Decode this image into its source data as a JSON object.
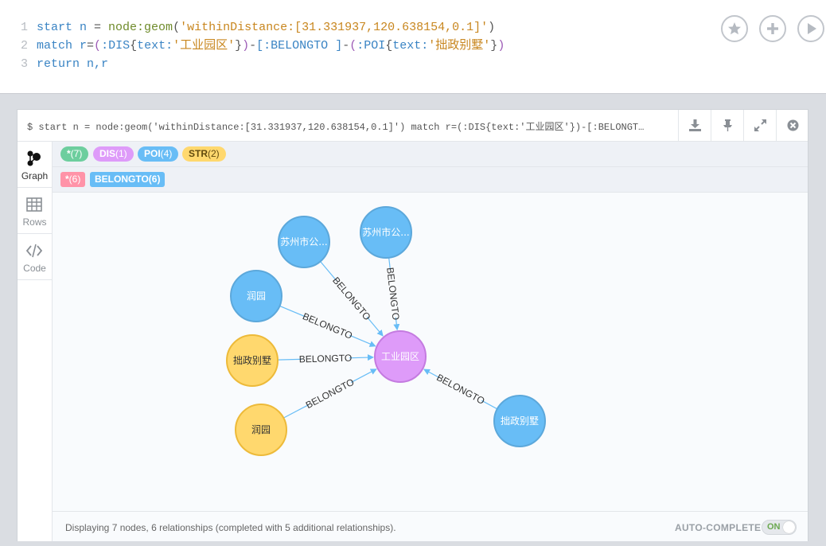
{
  "editor": {
    "line_numbers": [
      "1",
      "2",
      "3"
    ],
    "line1": {
      "kw": "start",
      "var": " n",
      "eq": " = ",
      "fn": "node:geom",
      "open": "(",
      "str": "'withinDistance:[31.331937,120.638154,0.1]'",
      "close": ")"
    },
    "line2": {
      "kw": "match",
      "var": " r",
      "eq": "=",
      "p1": "(",
      "label1": ":DIS",
      "b1": "{",
      "key1": "text:",
      "str1": "'工业园区'",
      "b2": "}",
      "p2": ")",
      "dash1": "-",
      "rel": "[:BELONGTO ]",
      "dash2": "-",
      "p3": "(",
      "label2": ":POI",
      "b3": "{",
      "key2": "text:",
      "str2": "'拙政别墅'",
      "b4": "}",
      "p4": ")"
    },
    "line3": {
      "kw": "return",
      "rest": " n,r"
    },
    "buttons": {
      "favorite_icon": "star-icon",
      "add_icon": "plus-icon",
      "run_icon": "play-icon"
    }
  },
  "frame": {
    "query": "$ start n = node:geom('withinDistance:[31.331937,120.638154,0.1]') match r=(:DIS{text:'工业园区'})-[:BELONGTO ...",
    "header_buttons": [
      "download-icon",
      "pin-icon",
      "expand-icon",
      "close-icon"
    ],
    "tabs": [
      {
        "label": "Graph",
        "icon": "graph-icon",
        "active": true
      },
      {
        "label": "Rows",
        "icon": "table-icon",
        "active": false
      },
      {
        "label": "Code",
        "icon": "code-icon",
        "active": false
      }
    ],
    "node_labels": [
      {
        "name": "*",
        "count": "(7)",
        "color": "#6dce9e"
      },
      {
        "name": "DIS",
        "count": "(1)",
        "color": "#de9bf9"
      },
      {
        "name": "POI",
        "count": "(4)",
        "color": "#68bdf6"
      },
      {
        "name": "STR",
        "count": "(2)",
        "color": "#ffd86e"
      }
    ],
    "rel_types": [
      {
        "name": "*",
        "count": "(6)",
        "color": "#ff93a8"
      },
      {
        "name": "BELONGTO",
        "count": "(6)",
        "color": "#68bdf6"
      }
    ],
    "graph": {
      "center": {
        "text": "工业园区",
        "color": "#de9bf9",
        "stroke": "#c47be0"
      },
      "nodes": [
        {
          "text": "苏州市公...",
          "color": "#68bdf6",
          "stroke": "#5ca8db"
        },
        {
          "text": "苏州市公...",
          "color": "#68bdf6",
          "stroke": "#5ca8db"
        },
        {
          "text": "润园",
          "color": "#68bdf6",
          "stroke": "#5ca8db"
        },
        {
          "text": "拙政别墅",
          "color": "#ffd86e",
          "stroke": "#edba39"
        },
        {
          "text": "润园",
          "color": "#ffd86e",
          "stroke": "#edba39"
        },
        {
          "text": "拙政别墅",
          "color": "#68bdf6",
          "stroke": "#5ca8db"
        }
      ],
      "edge_label": "BELONGTO",
      "edge_color": "#68bdf6"
    },
    "footer": {
      "status": "Displaying 7 nodes, 6 relationships (completed with 5 additional relationships).",
      "autocomplete_label": "AUTO-COMPLETE",
      "toggle_state": "ON"
    }
  }
}
